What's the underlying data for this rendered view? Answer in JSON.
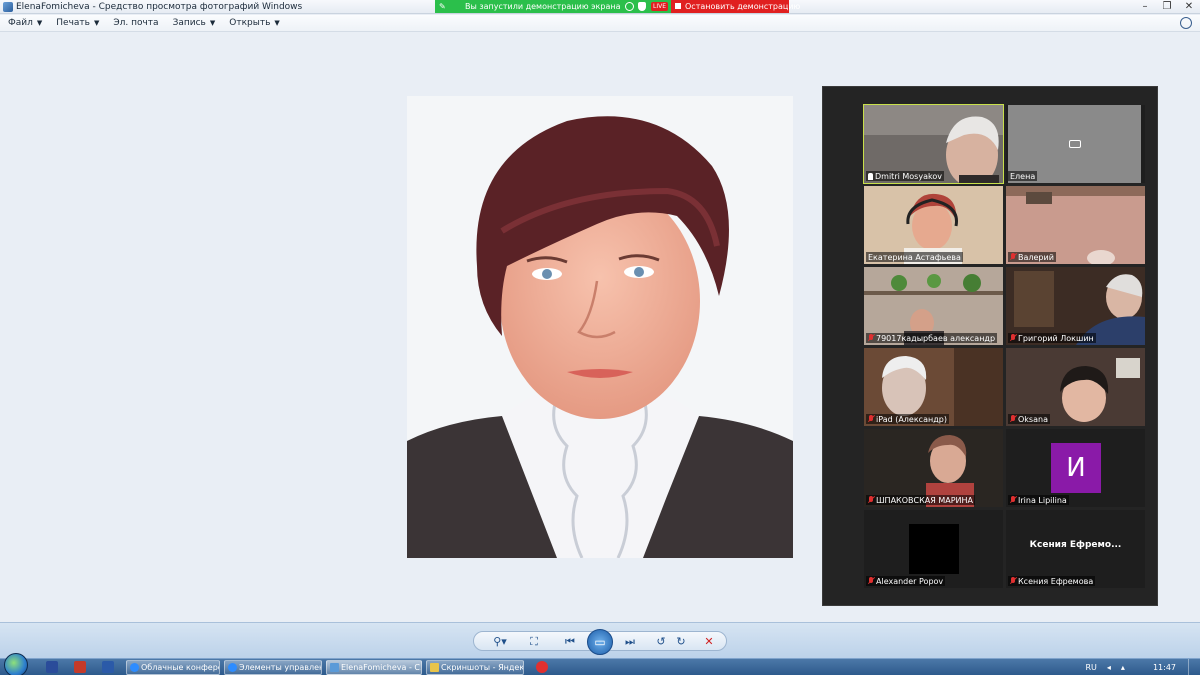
{
  "window": {
    "title": "ElenaFomicheva - Средство просмотра фотографий Windows",
    "minimize": "–",
    "maximize": "❐",
    "close": "✕"
  },
  "sharebar": {
    "message": "Вы запустили демонстрацию экрана",
    "live": "LIVE",
    "stop": "Остановить демонстрацию"
  },
  "menu": {
    "items": [
      {
        "label": "Файл"
      },
      {
        "label": "Печать"
      },
      {
        "label": "Эл. почта"
      },
      {
        "label": "Запись"
      },
      {
        "label": "Открыть"
      }
    ],
    "caret": "▼"
  },
  "gallery": {
    "tiles": [
      {
        "name": "Dmitri Mosyakov"
      },
      {
        "name": "Елена"
      },
      {
        "name": "Екатерина Астафьева"
      },
      {
        "name": "Валерий"
      },
      {
        "name": "79017кадырбаев александр"
      },
      {
        "name": "Григорий Локшин"
      },
      {
        "name": "iPad (Александр)"
      },
      {
        "name": "Oksana"
      },
      {
        "name": "ШПАКОВСКАЯ МАРИНА"
      },
      {
        "name": "Irina Lipilina",
        "initial": "И"
      },
      {
        "name": "Alexander Popov"
      },
      {
        "name": "Ксения Ефремова",
        "display": "Ксения  Ефремо..."
      }
    ]
  },
  "toolbar": {
    "zoom": "⚲▾",
    "fit": "⛶",
    "prev": "⏮",
    "slideshow": "▭",
    "next": "⏭",
    "rotate_left": "↺",
    "rotate_right": "↻",
    "delete": "✕"
  },
  "taskbar": {
    "tasks": [
      {
        "label": "Облачные конфере..."
      },
      {
        "label": "Элементы управлен..."
      },
      {
        "label": "ElenaFomicheva - С..."
      },
      {
        "label": "Скриншоты - Яндек..."
      }
    ],
    "lang": "RU",
    "clock": "11:47"
  }
}
